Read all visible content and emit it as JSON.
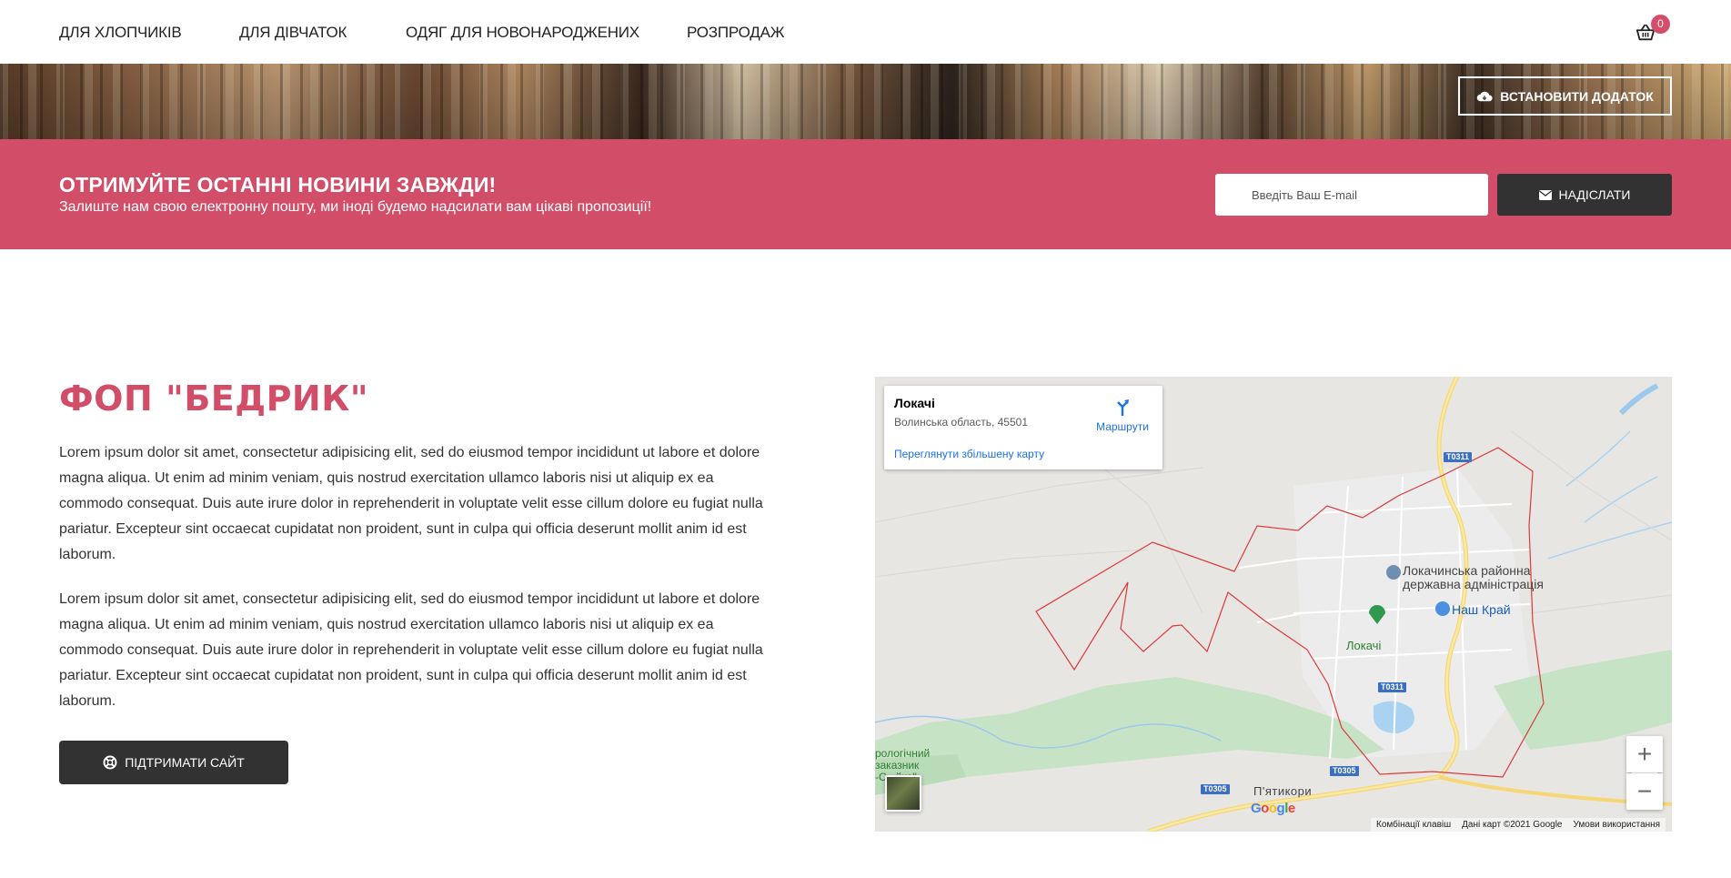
{
  "nav": {
    "items": [
      {
        "label": "ДЛЯ ХЛОПЧИКІВ"
      },
      {
        "label": "ДЛЯ ДІВЧАТОК"
      },
      {
        "label": "ОДЯГ ДЛЯ НОВОНАРОДЖЕНИХ"
      },
      {
        "label": "РОЗПРОДАЖ"
      }
    ],
    "cart_count": "0"
  },
  "banner": {
    "install_label": "ВСТАНОВИТИ ДОДАТОК"
  },
  "newsletter": {
    "title": "ОТРИМУЙТЕ ОСТАННІ НОВИНИ ЗАВЖДИ!",
    "subtitle": "Залиште нам свою електронну пошту, ми іноді будемо надсилати вам цікаві пропозиції!",
    "email_placeholder": "Введіть Ваш E-mail",
    "send_label": "НАДІСЛАТИ"
  },
  "about": {
    "heading": "ФОП \"БЕДРИК\"",
    "paragraphs": [
      "Lorem ipsum dolor sit amet, consectetur adipisicing elit, sed do eiusmod tempor incididunt ut labore et dolore magna aliqua. Ut enim ad minim veniam, quis nostrud exercitation ullamco laboris nisi ut aliquip ex ea commodo consequat. Duis aute irure dolor in reprehenderit in voluptate velit esse cillum dolore eu fugiat nulla pariatur. Excepteur sint occaecat cupidatat non proident, sunt in culpa qui officia deserunt mollit anim id est laborum.",
      "Lorem ipsum dolor sit amet, consectetur adipisicing elit, sed do eiusmod tempor incididunt ut labore et dolore magna aliqua. Ut enim ad minim veniam, quis nostrud exercitation ullamco laboris nisi ut aliquip ex ea commodo consequat. Duis aute irure dolor in reprehenderit in voluptate velit esse cillum dolore eu fugiat nulla pariatur. Excepteur sint occaecat cupidatat non proident, sunt in culpa qui officia deserunt mollit anim id est laborum."
    ],
    "support_label": "ПІДТРИМАТИ САЙТ"
  },
  "map": {
    "place_title": "Локачі",
    "place_address": "Волинська область, 45501",
    "directions_label": "Маршрути",
    "larger_map_link": "Переглянути збільшену карту",
    "labels": {
      "admin": "Локачинська районна державна адміністрація",
      "shop": "Наш Край",
      "town": "Локачі",
      "village": "П'ятикори",
      "reserve": "рологічний заказник -С...йка\""
    },
    "roads": [
      "T0311",
      "T0311",
      "T0305",
      "T0305"
    ],
    "zoom_in": "+",
    "zoom_out": "−",
    "google": "Google",
    "attribution": {
      "shortcuts": "Комбінації клавіш",
      "data": "Дані карт ©2021 Google",
      "terms": "Умови використання"
    }
  },
  "colors": {
    "accent": "#d24e68",
    "dark_button": "#323232",
    "link_blue": "#1a73e8"
  }
}
